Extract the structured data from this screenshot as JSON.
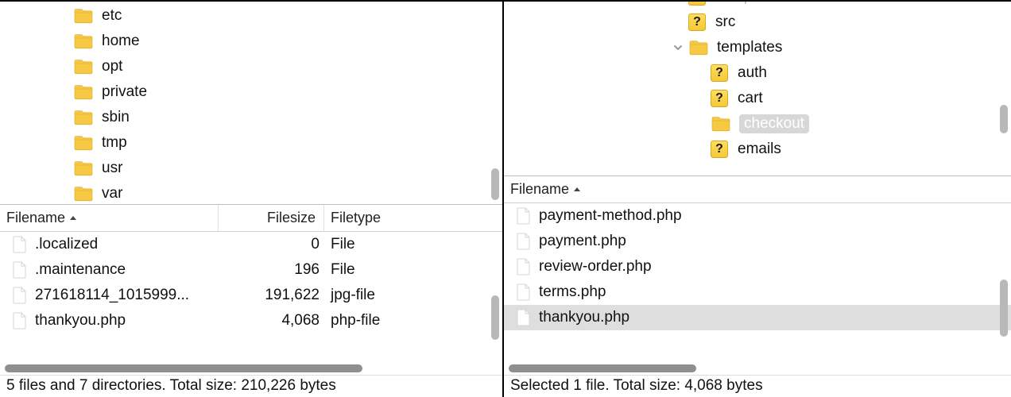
{
  "left": {
    "tree": [
      {
        "name": "etc",
        "icon": "folder",
        "indent": 70
      },
      {
        "name": "home",
        "icon": "folder",
        "indent": 70
      },
      {
        "name": "opt",
        "icon": "folder",
        "indent": 70
      },
      {
        "name": "private",
        "icon": "folder",
        "indent": 70
      },
      {
        "name": "sbin",
        "icon": "folder",
        "indent": 70
      },
      {
        "name": "tmp",
        "icon": "folder",
        "indent": 70
      },
      {
        "name": "usr",
        "icon": "folder",
        "indent": 70
      },
      {
        "name": "var",
        "icon": "folder",
        "indent": 70
      }
    ],
    "columns": {
      "name": "Filename",
      "size": "Filesize",
      "type": "Filetype"
    },
    "rows": [
      {
        "name": ".localized",
        "size": "0",
        "type": "File",
        "icon": "file"
      },
      {
        "name": ".maintenance",
        "size": "196",
        "type": "File",
        "icon": "file"
      },
      {
        "name": "271618114_1015999...",
        "size": "191,622",
        "type": "jpg-file",
        "icon": "file"
      },
      {
        "name": "thankyou.php",
        "size": "4,068",
        "type": "php-file",
        "icon": "file"
      }
    ],
    "status": "5 files and 7 directories. Total size: 210,226 bytes",
    "hscroll_width": 450
  },
  "right": {
    "tree": [
      {
        "name": "sample-data",
        "icon": "question",
        "indent": 210,
        "cut": true,
        "disclosure": false
      },
      {
        "name": "src",
        "icon": "question",
        "indent": 210,
        "disclosure": false
      },
      {
        "name": "templates",
        "icon": "folder",
        "indent": 210,
        "disclosure": true
      },
      {
        "name": "auth",
        "icon": "question",
        "indent": 238,
        "disclosure": false
      },
      {
        "name": "cart",
        "icon": "question",
        "indent": 238,
        "disclosure": false
      },
      {
        "name": "checkout",
        "icon": "folder",
        "indent": 238,
        "disclosure": false,
        "selected": true
      },
      {
        "name": "emails",
        "icon": "question",
        "indent": 238,
        "disclosure": false
      }
    ],
    "columns": {
      "name": "Filename"
    },
    "rows": [
      {
        "name": "payment-method.php",
        "icon": "file"
      },
      {
        "name": "payment.php",
        "icon": "file"
      },
      {
        "name": "review-order.php",
        "icon": "file"
      },
      {
        "name": "terms.php",
        "icon": "file"
      },
      {
        "name": "thankyou.php",
        "icon": "file",
        "selected": true
      }
    ],
    "status": "Selected 1 file. Total size: 4,068 bytes",
    "hscroll_width": 236
  }
}
